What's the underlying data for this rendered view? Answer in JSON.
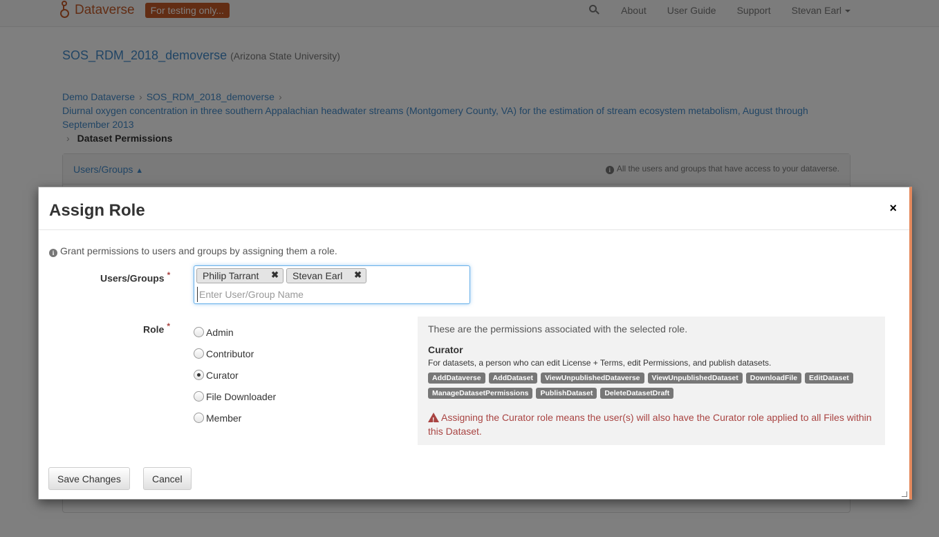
{
  "navbar": {
    "brand": "Dataverse",
    "badge": "For testing only...",
    "links": [
      "About",
      "User Guide",
      "Support"
    ],
    "user": "Stevan Earl",
    "search_icon": "search-icon"
  },
  "dataverse": {
    "title": "SOS_RDM_2018_demoverse",
    "affiliation": "(Arizona State University)"
  },
  "breadcrumb": {
    "items": [
      "Demo Dataverse",
      "SOS_RDM_2018_demoverse",
      "Diurnal oxygen concentration in three southern Appalachian headwater streams (Montgomery County, VA) for the estimation of stream ecosystem metabolism, August through September 2013"
    ],
    "current": "Dataset Permissions"
  },
  "panel": {
    "title": "Users/Groups",
    "info": "All the users and groups that have access to your dataverse."
  },
  "modal": {
    "title": "Assign Role",
    "close": "×",
    "intro": "Grant permissions to users and groups by assigning them a role.",
    "users_label": "Users/Groups",
    "role_label": "Role",
    "required_mark": "*",
    "tokens": [
      "Philip Tarrant",
      "Stevan Earl"
    ],
    "token_remove": "✖",
    "input_placeholder": "Enter User/Group Name",
    "roles": [
      "Admin",
      "Contributor",
      "Curator",
      "File Downloader",
      "Member"
    ],
    "selected_role": "Curator",
    "perm_intro": "These are the permissions associated with the selected role.",
    "perm_role": "Curator",
    "perm_desc": "For datasets, a person who can edit License + Terms, edit Permissions, and publish datasets.",
    "permissions": [
      "AddDataverse",
      "AddDataset",
      "ViewUnpublishedDataverse",
      "ViewUnpublishedDataset",
      "DownloadFile",
      "EditDataset",
      "ManageDatasetPermissions",
      "PublishDataset",
      "DeleteDatasetDraft"
    ],
    "warning": "Assigning the Curator role means the user(s) will also have the Curator role applied to all Files within this Dataset.",
    "save_label": "Save Changes",
    "cancel_label": "Cancel"
  },
  "colors": {
    "brand": "#c55b28",
    "link": "#428bca",
    "warning": "#a94442"
  }
}
